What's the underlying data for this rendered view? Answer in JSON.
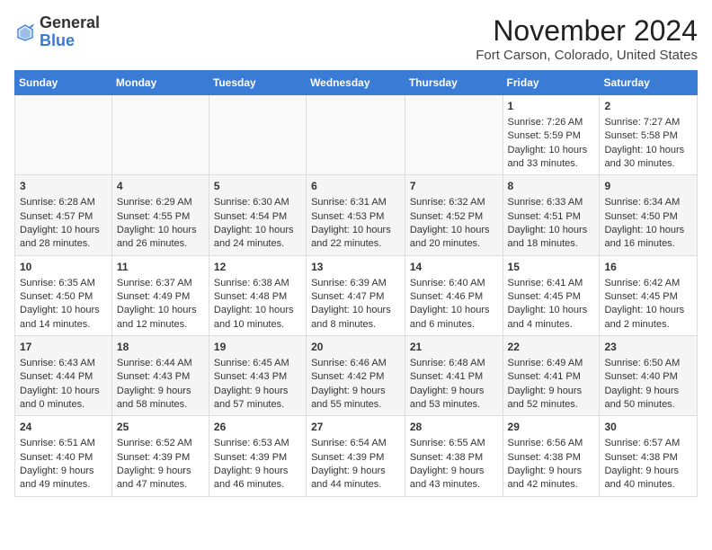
{
  "logo": {
    "general": "General",
    "blue": "Blue"
  },
  "header": {
    "title": "November 2024",
    "location": "Fort Carson, Colorado, United States"
  },
  "days_of_week": [
    "Sunday",
    "Monday",
    "Tuesday",
    "Wednesday",
    "Thursday",
    "Friday",
    "Saturday"
  ],
  "weeks": [
    [
      {
        "day": "",
        "info": ""
      },
      {
        "day": "",
        "info": ""
      },
      {
        "day": "",
        "info": ""
      },
      {
        "day": "",
        "info": ""
      },
      {
        "day": "",
        "info": ""
      },
      {
        "day": "1",
        "info": "Sunrise: 7:26 AM\nSunset: 5:59 PM\nDaylight: 10 hours and 33 minutes."
      },
      {
        "day": "2",
        "info": "Sunrise: 7:27 AM\nSunset: 5:58 PM\nDaylight: 10 hours and 30 minutes."
      }
    ],
    [
      {
        "day": "3",
        "info": "Sunrise: 6:28 AM\nSunset: 4:57 PM\nDaylight: 10 hours and 28 minutes."
      },
      {
        "day": "4",
        "info": "Sunrise: 6:29 AM\nSunset: 4:55 PM\nDaylight: 10 hours and 26 minutes."
      },
      {
        "day": "5",
        "info": "Sunrise: 6:30 AM\nSunset: 4:54 PM\nDaylight: 10 hours and 24 minutes."
      },
      {
        "day": "6",
        "info": "Sunrise: 6:31 AM\nSunset: 4:53 PM\nDaylight: 10 hours and 22 minutes."
      },
      {
        "day": "7",
        "info": "Sunrise: 6:32 AM\nSunset: 4:52 PM\nDaylight: 10 hours and 20 minutes."
      },
      {
        "day": "8",
        "info": "Sunrise: 6:33 AM\nSunset: 4:51 PM\nDaylight: 10 hours and 18 minutes."
      },
      {
        "day": "9",
        "info": "Sunrise: 6:34 AM\nSunset: 4:50 PM\nDaylight: 10 hours and 16 minutes."
      }
    ],
    [
      {
        "day": "10",
        "info": "Sunrise: 6:35 AM\nSunset: 4:50 PM\nDaylight: 10 hours and 14 minutes."
      },
      {
        "day": "11",
        "info": "Sunrise: 6:37 AM\nSunset: 4:49 PM\nDaylight: 10 hours and 12 minutes."
      },
      {
        "day": "12",
        "info": "Sunrise: 6:38 AM\nSunset: 4:48 PM\nDaylight: 10 hours and 10 minutes."
      },
      {
        "day": "13",
        "info": "Sunrise: 6:39 AM\nSunset: 4:47 PM\nDaylight: 10 hours and 8 minutes."
      },
      {
        "day": "14",
        "info": "Sunrise: 6:40 AM\nSunset: 4:46 PM\nDaylight: 10 hours and 6 minutes."
      },
      {
        "day": "15",
        "info": "Sunrise: 6:41 AM\nSunset: 4:45 PM\nDaylight: 10 hours and 4 minutes."
      },
      {
        "day": "16",
        "info": "Sunrise: 6:42 AM\nSunset: 4:45 PM\nDaylight: 10 hours and 2 minutes."
      }
    ],
    [
      {
        "day": "17",
        "info": "Sunrise: 6:43 AM\nSunset: 4:44 PM\nDaylight: 10 hours and 0 minutes."
      },
      {
        "day": "18",
        "info": "Sunrise: 6:44 AM\nSunset: 4:43 PM\nDaylight: 9 hours and 58 minutes."
      },
      {
        "day": "19",
        "info": "Sunrise: 6:45 AM\nSunset: 4:43 PM\nDaylight: 9 hours and 57 minutes."
      },
      {
        "day": "20",
        "info": "Sunrise: 6:46 AM\nSunset: 4:42 PM\nDaylight: 9 hours and 55 minutes."
      },
      {
        "day": "21",
        "info": "Sunrise: 6:48 AM\nSunset: 4:41 PM\nDaylight: 9 hours and 53 minutes."
      },
      {
        "day": "22",
        "info": "Sunrise: 6:49 AM\nSunset: 4:41 PM\nDaylight: 9 hours and 52 minutes."
      },
      {
        "day": "23",
        "info": "Sunrise: 6:50 AM\nSunset: 4:40 PM\nDaylight: 9 hours and 50 minutes."
      }
    ],
    [
      {
        "day": "24",
        "info": "Sunrise: 6:51 AM\nSunset: 4:40 PM\nDaylight: 9 hours and 49 minutes."
      },
      {
        "day": "25",
        "info": "Sunrise: 6:52 AM\nSunset: 4:39 PM\nDaylight: 9 hours and 47 minutes."
      },
      {
        "day": "26",
        "info": "Sunrise: 6:53 AM\nSunset: 4:39 PM\nDaylight: 9 hours and 46 minutes."
      },
      {
        "day": "27",
        "info": "Sunrise: 6:54 AM\nSunset: 4:39 PM\nDaylight: 9 hours and 44 minutes."
      },
      {
        "day": "28",
        "info": "Sunrise: 6:55 AM\nSunset: 4:38 PM\nDaylight: 9 hours and 43 minutes."
      },
      {
        "day": "29",
        "info": "Sunrise: 6:56 AM\nSunset: 4:38 PM\nDaylight: 9 hours and 42 minutes."
      },
      {
        "day": "30",
        "info": "Sunrise: 6:57 AM\nSunset: 4:38 PM\nDaylight: 9 hours and 40 minutes."
      }
    ]
  ]
}
